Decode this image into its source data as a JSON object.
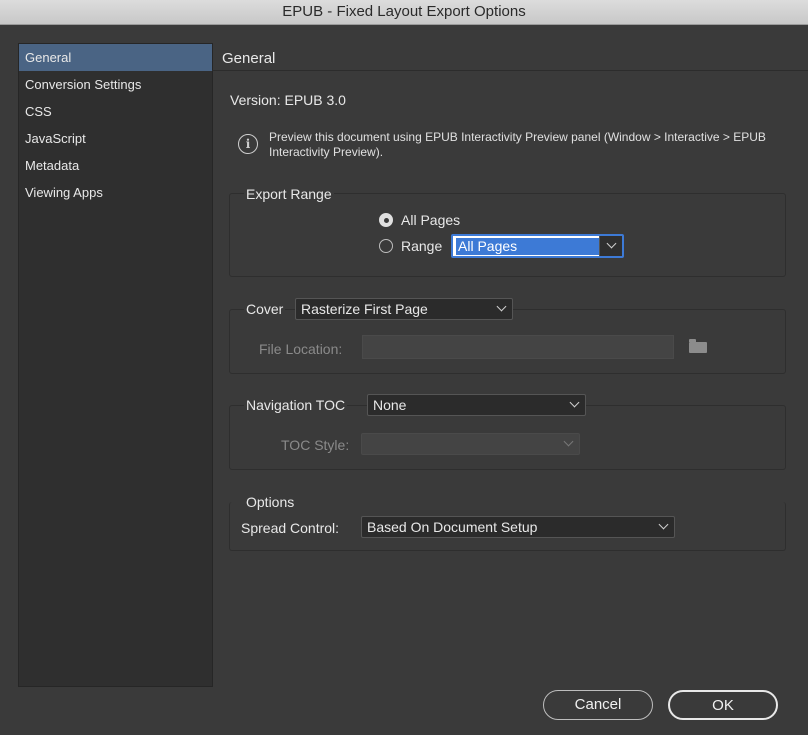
{
  "window": {
    "title": "EPUB - Fixed Layout Export Options"
  },
  "sidebar": {
    "items": [
      {
        "label": "General",
        "selected": true
      },
      {
        "label": "Conversion Settings",
        "selected": false
      },
      {
        "label": "CSS",
        "selected": false
      },
      {
        "label": "JavaScript",
        "selected": false
      },
      {
        "label": "Metadata",
        "selected": false
      },
      {
        "label": "Viewing Apps",
        "selected": false
      }
    ]
  },
  "main": {
    "section_title": "General",
    "version": "Version: EPUB 3.0",
    "info_text": "Preview this document using EPUB Interactivity Preview panel (Window > Interactive > EPUB Interactivity Preview).",
    "export_range": {
      "legend": "Export Range",
      "all_pages_label": "All Pages",
      "range_label": "Range",
      "range_value": "All Pages",
      "selected": "all_pages"
    },
    "cover": {
      "label": "Cover",
      "value": "Rasterize First Page",
      "file_location_label": "File Location:",
      "file_location_value": ""
    },
    "navigation": {
      "label": "Navigation TOC",
      "value": "None",
      "toc_style_label": "TOC Style:",
      "toc_style_value": ""
    },
    "options": {
      "legend": "Options",
      "spread_control_label": "Spread Control:",
      "spread_control_value": "Based On Document Setup"
    }
  },
  "buttons": {
    "cancel": "Cancel",
    "ok": "OK"
  },
  "colors": {
    "accent": "#3d7ad6",
    "sidebar_selected": "#4a6484",
    "background": "#3a3a3a"
  }
}
